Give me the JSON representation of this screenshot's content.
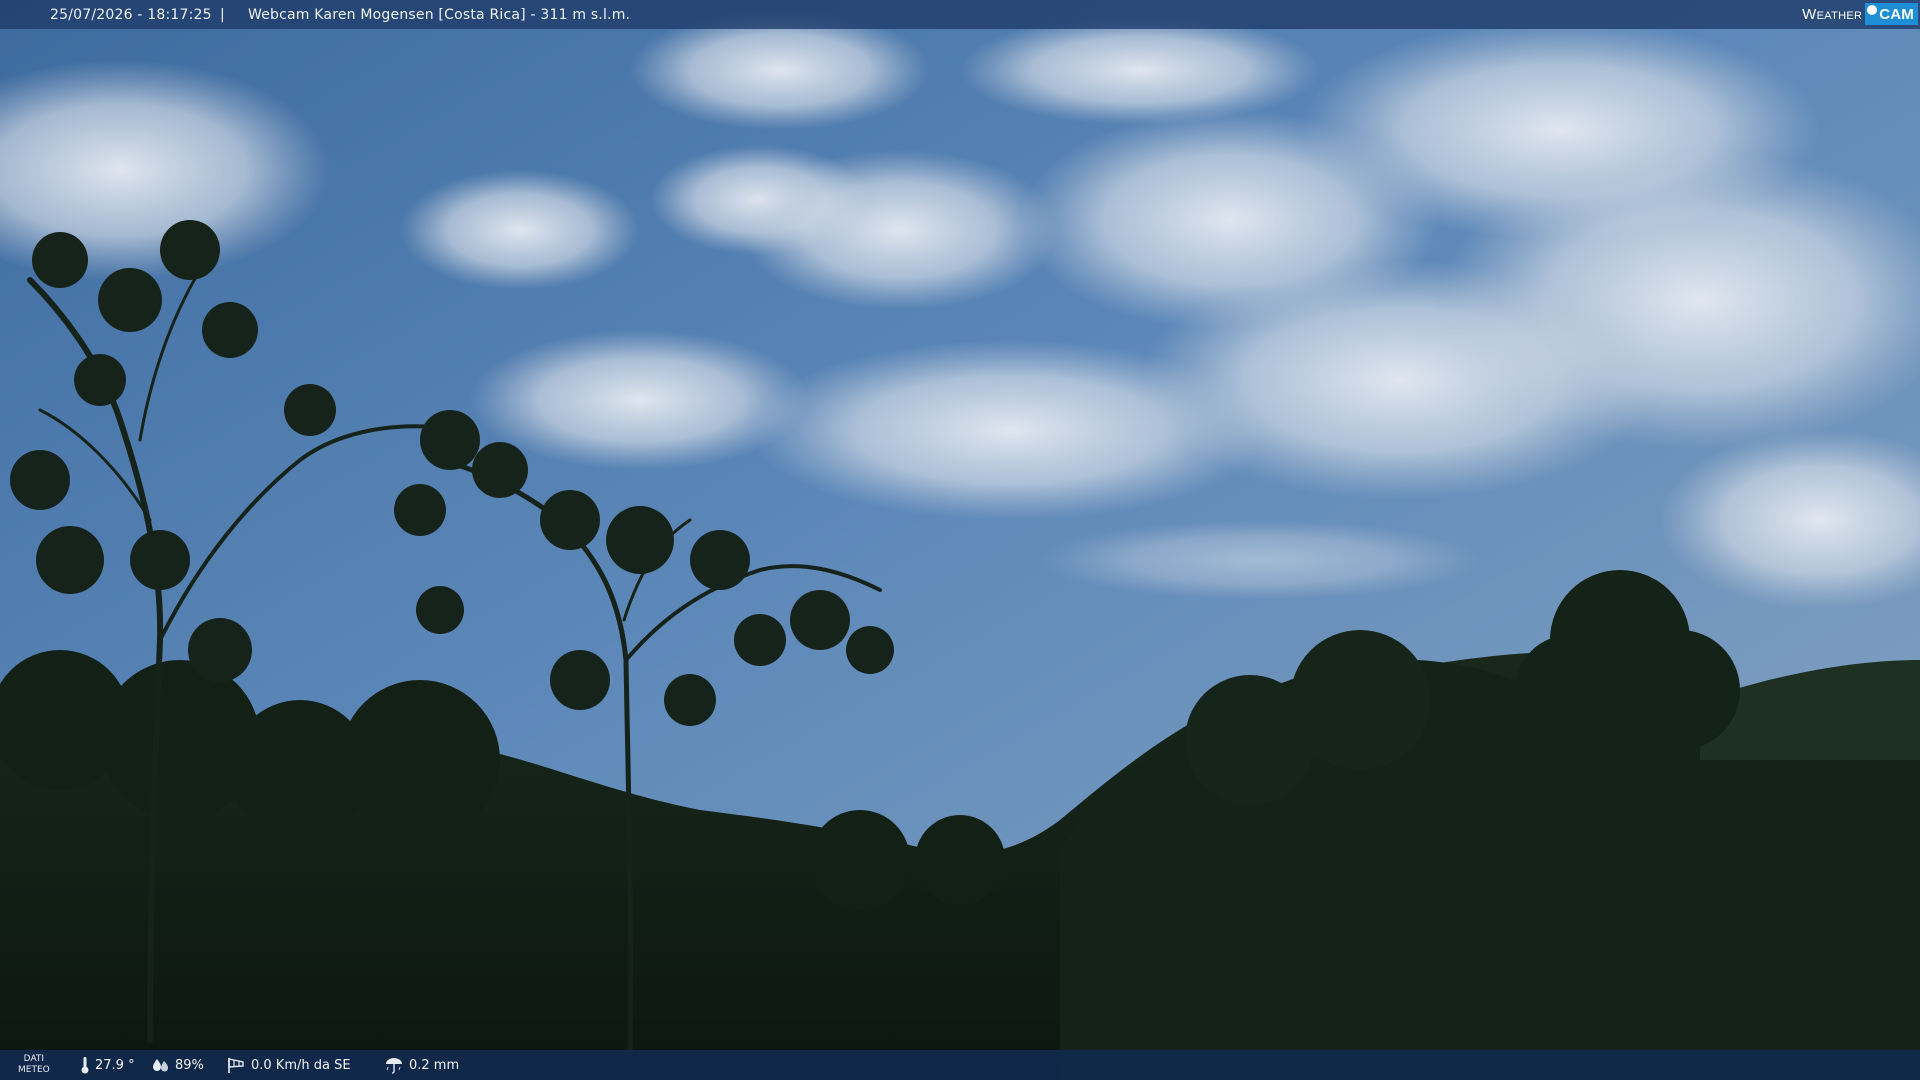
{
  "window": {
    "timestamp": "25/07/2026 - 18:17:25",
    "separator": "|",
    "title": "Webcam Karen Mogensen [Costa Rica]  - 311 m s.l.m."
  },
  "logo": {
    "weather_text": "Weather",
    "cam_text": "CAM"
  },
  "meteo": {
    "label_line1": "DATI",
    "label_line2": "METEO",
    "temperature": "27.9 °",
    "humidity": "89%",
    "wind": "0.0 Km/h da SE",
    "rain": "0.2 mm"
  },
  "icons": {
    "temperature": "thermometer-icon",
    "humidity": "humidity-drop-icon",
    "wind": "windsock-icon",
    "rain": "rain-umbrella-icon"
  },
  "colors": {
    "topbar": "#1c3a69",
    "bottombar": "#102a4e",
    "brand_badge": "#1e8fd6"
  }
}
